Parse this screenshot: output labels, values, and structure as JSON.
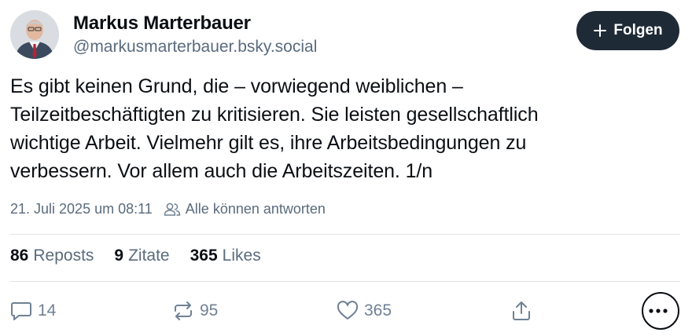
{
  "author": {
    "name": "Markus Marterbauer",
    "handle": "@markusmarterbauer.bsky.social"
  },
  "follow_button": {
    "icon": "plus-icon",
    "label": "Folgen"
  },
  "post": {
    "lines": [
      "Es gibt keinen Grund, die – vorwiegend weiblichen –",
      "Teilzeitbeschäftigten zu kritisieren. Sie leisten gesellschaftlich",
      "wichtige Arbeit. Vielmehr gilt es, ihre Arbeitsbedingungen zu",
      "verbessern. Vor allem auch die Arbeitszeiten. 1/n"
    ]
  },
  "meta": {
    "timestamp": "21. Juli 2025 um 08:11",
    "reply_setting": "Alle können antworten",
    "reply_setting_icon": "people-icon"
  },
  "stats": {
    "reposts_count": "86",
    "reposts_label": "Reposts",
    "quotes_count": "9",
    "quotes_label": "Zitate",
    "likes_count": "365",
    "likes_label": "Likes"
  },
  "actions": {
    "reply_count": "14",
    "repost_count": "95",
    "like_count": "365"
  },
  "colors": {
    "follow_bg": "#1f2a37",
    "muted_text": "#5a6b7d",
    "icon_gray": "#6f8194",
    "divider": "#dfe4e9"
  }
}
